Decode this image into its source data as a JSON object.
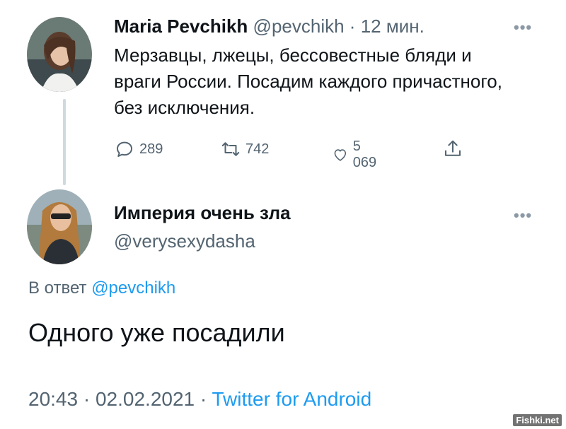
{
  "tweet1": {
    "author_name": "Maria Pevchikh",
    "handle": "@pevchikh",
    "separator": "·",
    "time": "12 мин.",
    "more": "•••",
    "text": "Мерзавцы, лжецы, бессовестные бляди и враги России. Посадим каждого причастного, без исключения.",
    "replies": "289",
    "retweets": "742",
    "likes": "5 069"
  },
  "tweet2": {
    "author_name": "Империя очень зла",
    "handle": "@verysexydasha",
    "more": "•••",
    "reply_prefix": "В ответ",
    "reply_mention": "@pevchikh",
    "text": "Одного уже посадили",
    "time": "20:43",
    "separator": "·",
    "date": "02.02.2021",
    "separator2": "·",
    "source": "Twitter for Android"
  },
  "watermark": "Fishki.net",
  "colors": {
    "link": "#1d9bf0",
    "secondary": "#536471",
    "text": "#0f1419",
    "thread_line": "#cfd9de"
  }
}
